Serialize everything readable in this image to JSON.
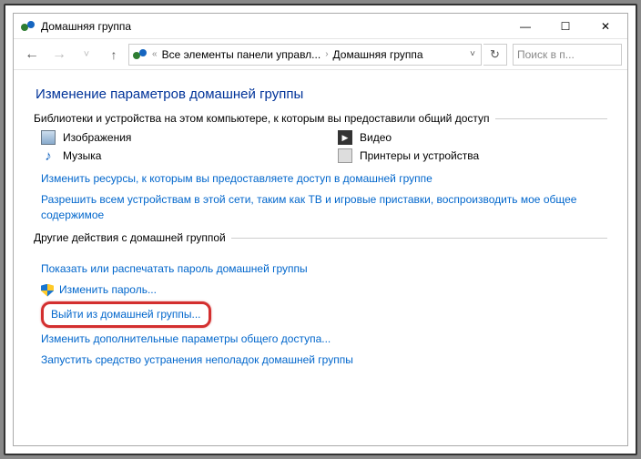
{
  "window": {
    "title": "Домашняя группа"
  },
  "breadcrumb": {
    "item1": "Все элементы панели управл...",
    "item2": "Домашняя группа"
  },
  "search": {
    "placeholder": "Поиск в п..."
  },
  "page": {
    "heading": "Изменение параметров домашней группы"
  },
  "section1": {
    "legend": "Библиотеки и устройства на этом компьютере, к которым вы предоставили общий доступ",
    "items": {
      "pictures": "Изображения",
      "video": "Видео",
      "music": "Музыка",
      "printers": "Принтеры и устройства"
    },
    "links": {
      "changeshare": "Изменить ресурсы, к которым вы предоставляете доступ в домашней группе",
      "allowdevices": "Разрешить всем устройствам в этой сети, таким как ТВ и игровые приставки, воспроизводить мое общее содержимое"
    }
  },
  "section2": {
    "legend": "Другие действия с домашней группой",
    "links": {
      "showpwd": "Показать или распечатать пароль домашней группы",
      "changepwd": "Изменить пароль...",
      "leave": "Выйти из домашней группы...",
      "advshare": "Изменить дополнительные параметры общего доступа...",
      "troubleshoot": "Запустить средство устранения неполадок домашней группы"
    }
  }
}
